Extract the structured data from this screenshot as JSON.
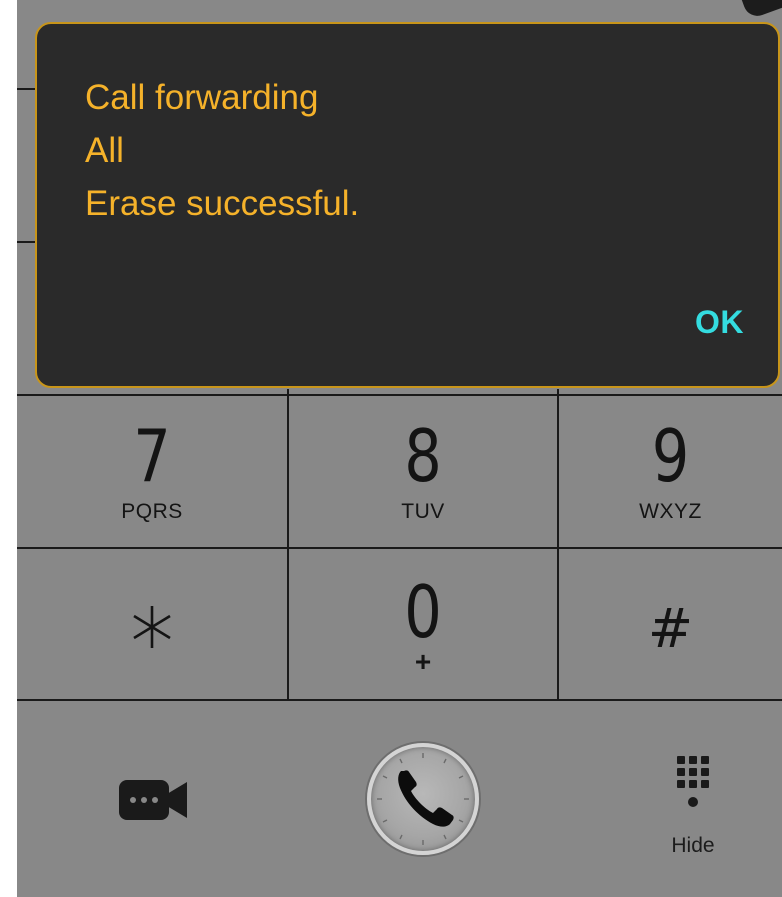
{
  "dialog": {
    "line1": "Call forwarding",
    "line2": "All",
    "line3": "Erase successful.",
    "ok_label": "OK"
  },
  "keypad": {
    "k7": {
      "digit": "7",
      "letters": "PQRS"
    },
    "k8": {
      "digit": "8",
      "letters": "TUV"
    },
    "k9": {
      "digit": "9",
      "letters": "WXYZ"
    },
    "kstar": {
      "digit": "*"
    },
    "k0": {
      "digit": "0",
      "letters": "+"
    },
    "khash": {
      "digit": "#"
    }
  },
  "bottom_bar": {
    "video_icon": "video-call-icon",
    "call_icon": "phone-icon",
    "hide_icon": "dialpad-icon",
    "hide_label": "Hide"
  },
  "colors": {
    "dialog_bg": "#2a2a2a",
    "dialog_text": "#f5b22a",
    "dialog_border": "#c8951a",
    "ok_text": "#34dce0",
    "screen_bg": "#888888"
  }
}
